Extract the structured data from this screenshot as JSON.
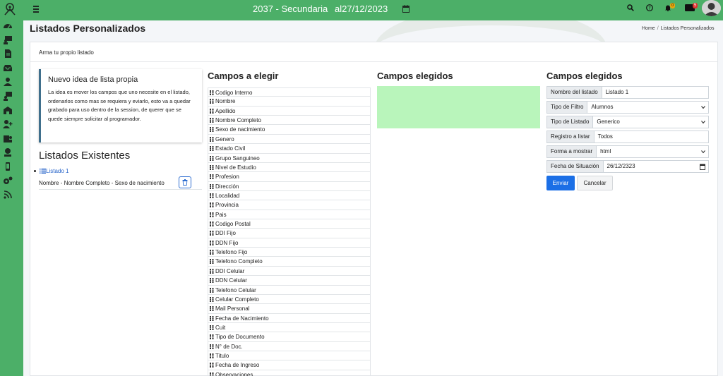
{
  "topbar": {
    "title": "2037 - Secundaria",
    "date_label": "al27/12/2023",
    "notifications_count": "0",
    "messages_count": "5"
  },
  "page": {
    "title": "Listados Personalizados",
    "breadcrumb_home": "Home",
    "breadcrumb_current": "Listados Personalizados"
  },
  "card": {
    "header": "Arma tu propio listado"
  },
  "info": {
    "title": "Nuevo idea de lista propia",
    "text": "La idea es mover los campos que uno necesite en el listado, ordenarlos como mas se requiera y eviarlo, esto va a quedar grabado para uso dentro de la session, de querer que se quede siempre solicitar al programador."
  },
  "existentes": {
    "title": "Listados Existentes",
    "items": [
      {
        "label": "Listado 1",
        "description": "Nombre - Nombre Completo - Sexo de nacimiento"
      }
    ]
  },
  "campos_elegir": {
    "title": "Campos a elegir",
    "fields": [
      "Codigo Interno",
      "Nombre",
      "Apellido",
      "Nombre Completo",
      "Sexo de nacimiento",
      "Genero",
      "Estado Civil",
      "Grupo Sanguineo",
      "Nivel de Estudio",
      "Profesion",
      "Dirección",
      "Localidad",
      "Provincia",
      "Pais",
      "Codigo Postal",
      "DDI Fijo",
      "DDN Fijo",
      "Telefono Fijo",
      "Telefono Completo",
      "DDI Celular",
      "DDN Celular",
      "Telefono Celular",
      "Celular Completo",
      "Mail Personal",
      "Fecha de Nacimiento",
      "Cuit",
      "Tipo de Documento",
      "N° de Doc.",
      "Titulo",
      "Fecha de Ingreso",
      "Observaciones"
    ]
  },
  "campos_elegidos": {
    "title": "Campos elegidos",
    "drop_color": "#b9f5bb"
  },
  "form": {
    "title": "Campos elegidos",
    "rows": [
      {
        "label": "Nombre del listado",
        "value": "Listado 1",
        "kind": "input"
      },
      {
        "label": "Tipo de Filtro",
        "value": "Alumnos",
        "kind": "select"
      },
      {
        "label": "Tipo de Listado",
        "value": "Generico",
        "kind": "select"
      },
      {
        "label": "Registro a listar",
        "value": "Todos",
        "kind": "input"
      },
      {
        "label": "Forma a mostrar",
        "value": "html",
        "kind": "select"
      },
      {
        "label": "Fecha de Situación",
        "value": "26/12/2323",
        "kind": "date"
      }
    ],
    "submit": "Enviar",
    "cancel": "Cancelar"
  },
  "colors": {
    "brand_green": "#4caf68",
    "primary_blue": "#1b6fe6"
  }
}
